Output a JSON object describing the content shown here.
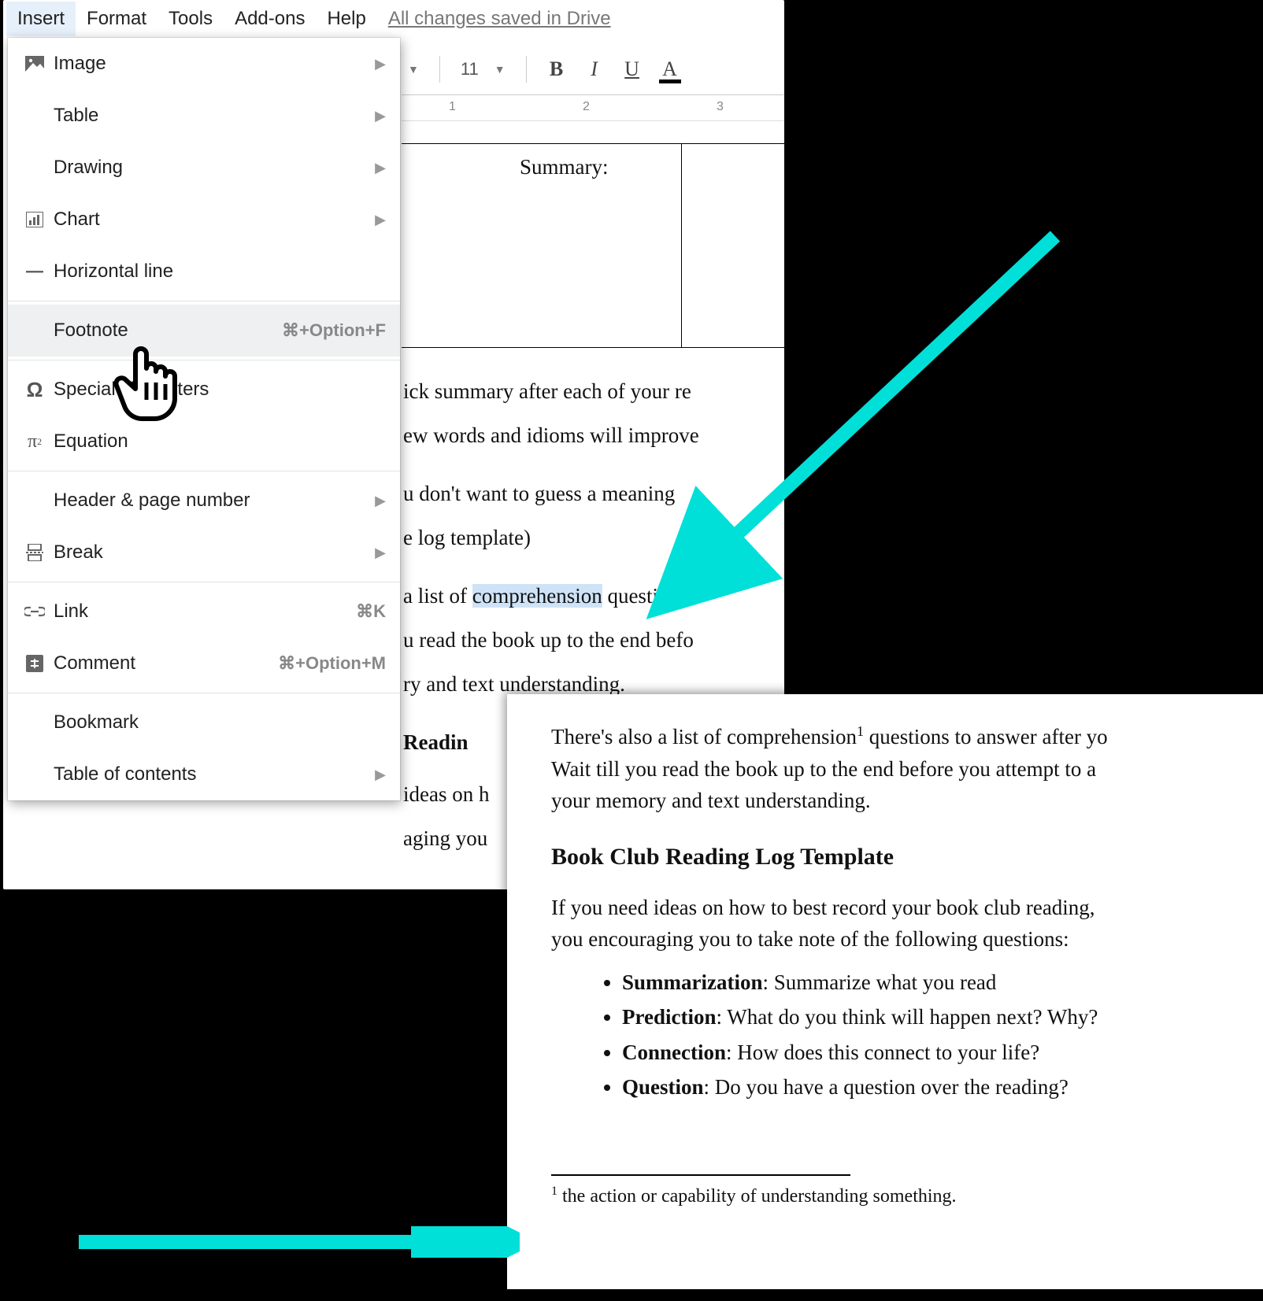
{
  "menubar": {
    "items": [
      "Insert",
      "Format",
      "Tools",
      "Add-ons",
      "Help"
    ],
    "active_index": 0,
    "save_status": "All changes saved in Drive"
  },
  "dropdown": {
    "groups": [
      [
        {
          "icon": "image",
          "label": "Image",
          "has_submenu": true
        },
        {
          "icon": "",
          "label": "Table",
          "has_submenu": true
        },
        {
          "icon": "",
          "label": "Drawing",
          "has_submenu": true
        },
        {
          "icon": "chart",
          "label": "Chart",
          "has_submenu": true
        },
        {
          "icon": "hline",
          "label": "Horizontal line"
        }
      ],
      [
        {
          "icon": "",
          "label": "Footnote",
          "shortcut": "⌘+Option+F",
          "hover": true
        }
      ],
      [
        {
          "icon": "omega",
          "label": "Special characters"
        },
        {
          "icon": "pi2",
          "label": "Equation"
        }
      ],
      [
        {
          "icon": "",
          "label": "Header & page number",
          "has_submenu": true
        },
        {
          "icon": "break",
          "label": "Break",
          "has_submenu": true
        }
      ],
      [
        {
          "icon": "link",
          "label": "Link",
          "shortcut": "⌘K"
        },
        {
          "icon": "comment",
          "label": "Comment",
          "shortcut": "⌘+Option+M"
        }
      ],
      [
        {
          "icon": "",
          "label": "Bookmark"
        },
        {
          "icon": "",
          "label": "Table of contents",
          "has_submenu": true
        }
      ]
    ]
  },
  "toolbar": {
    "font_size": "11",
    "buttons": {
      "bold": "B",
      "italic": "I",
      "underline": "U",
      "text_color": "A"
    }
  },
  "ruler": {
    "marks": [
      "1",
      "2",
      "3"
    ]
  },
  "document": {
    "summary_label": "Summary:",
    "para1a": "ick summary after each of your re",
    "para1b": "ew words and idioms will improve",
    "para2a": "u don't want to guess a meaning",
    "para2b": "e log template)",
    "para3a_before": " a list of ",
    "para3a_highlight": "comprehension",
    "para3a_after": " questions",
    "para3b": "u read the book up to the end befo",
    "para3c": "ry and text understanding.",
    "heading_partial": " Readin",
    "para4a": " ideas on h",
    "para4b": "aging you"
  },
  "overlay": {
    "p1a_before": "There's also a list of comprehension",
    "p1_sup": "1",
    "p1a_after": " questions to answer after yo",
    "p1b": "Wait till you read the book up to the end before you attempt to a",
    "p1c": "your memory and text understanding.",
    "heading": "Book Club Reading Log Template",
    "p2a": "If you need ideas on how to best record your book club reading, ",
    "p2b": "you encouraging you to take note of the following questions:",
    "bullets": [
      {
        "term": "Summarization",
        "desc": ": Summarize what you read"
      },
      {
        "term": "Prediction",
        "desc": ": What do you think will happen next? Why?"
      },
      {
        "term": "Connection",
        "desc": ": How does this connect to your life?"
      },
      {
        "term": "Question",
        "desc": ": Do you have a question over the reading?"
      }
    ],
    "footnote_num": "1",
    "footnote_text": " the action or capability of understanding something."
  },
  "colors": {
    "arrow": "#00e0d8"
  }
}
